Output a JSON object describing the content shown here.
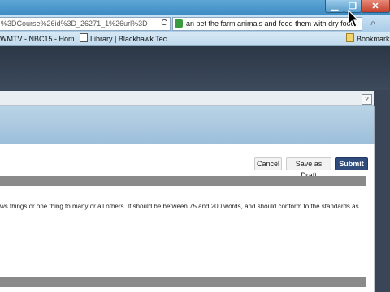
{
  "window": {
    "minimize_glyph": "▁",
    "maximize_glyph": "❐",
    "close_glyph": "✕"
  },
  "navbar": {
    "url_text": "%3DCourse%26id%3D_26271_1%26url%3D",
    "reload_glyph": "C",
    "search_text": "an pet the farm animals and feed them with dry food",
    "search_go_glyph": "⌕"
  },
  "bookmarks": {
    "items": [
      {
        "label": "WMTV - NBC15 - Hom..."
      },
      {
        "label": "Library | Blackhawk Tec..."
      }
    ],
    "folder_label": "Bookmarks"
  },
  "frame": {
    "help_glyph": "?"
  },
  "actions": {
    "cancel_label": "Cancel",
    "draft_label": "Save as Draft",
    "submit_label": "Submit"
  },
  "instructions_text": "ws things or one thing to many or all others.  It should be between 75 and 200 words, and should conform to the standards as",
  "colors": {
    "submit_bg": "#2f4c7c",
    "header_band": "#9dbfda",
    "section_bar": "#8a8a8a"
  }
}
